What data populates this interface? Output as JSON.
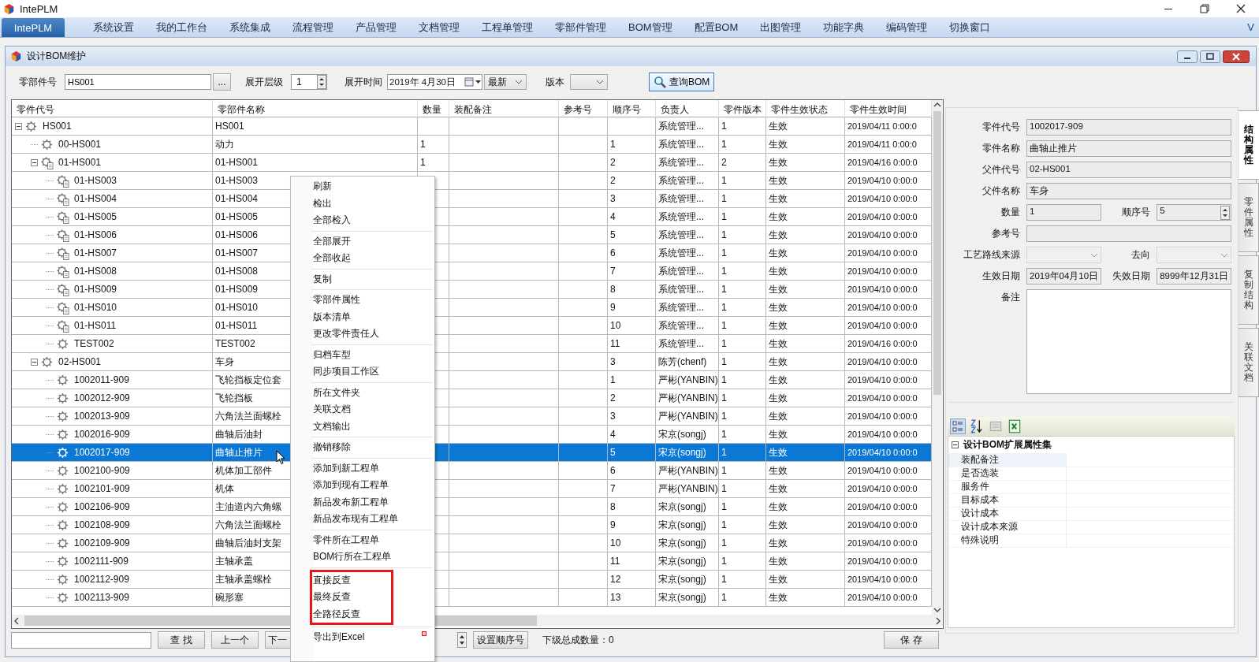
{
  "app_window": {
    "title": "IntePLM"
  },
  "menu_bar": {
    "items": [
      {
        "label": "IntePLM",
        "selected": true
      },
      {
        "label": "系统设置",
        "selected": false
      },
      {
        "label": "我的工作台",
        "selected": false
      },
      {
        "label": "系统集成",
        "selected": false
      },
      {
        "label": "流程管理",
        "selected": false
      },
      {
        "label": "产品管理",
        "selected": false
      },
      {
        "label": "文档管理",
        "selected": false
      },
      {
        "label": "工程单管理",
        "selected": false
      },
      {
        "label": "零部件管理",
        "selected": false
      },
      {
        "label": "BOM管理",
        "selected": false
      },
      {
        "label": "配置BOM",
        "selected": false
      },
      {
        "label": "出图管理",
        "selected": false
      },
      {
        "label": "功能字典",
        "selected": false
      },
      {
        "label": "编码管理",
        "selected": false
      },
      {
        "label": "切换窗口",
        "selected": false
      }
    ],
    "toggle": "V"
  },
  "document_window": {
    "title": "设计BOM维护"
  },
  "query_bar": {
    "part_no_label": "零部件号",
    "part_no": "HS001",
    "browse_button": "...",
    "level_label": "展开层级",
    "level": "1",
    "time_label": "展开时间",
    "date": "2019年 4月30日",
    "mode": "最新",
    "version_label": "版本",
    "query_button": "查询BOM"
  },
  "table": {
    "columns": [
      "零件代号",
      "零部件名称",
      "数量",
      "装配备注",
      "参考号",
      "顺序号",
      "负责人",
      "零件版本",
      "零件生效状态",
      "零件生效时间"
    ],
    "rows": [
      {
        "code": "HS001",
        "name": "HS001",
        "owner": "系统管理...",
        "version": "1",
        "status": "生效",
        "time": "2019/04/11 0:00:0",
        "kind": "plain",
        "selected": false,
        "expanded": true,
        "children": [
          {
            "code": "00-HS001",
            "name": "动力",
            "qty": "1",
            "seq": "1",
            "owner": "系统管理...",
            "version": "1",
            "status": "生效",
            "time": "2019/04/11 0:00:0",
            "kind": "plain",
            "selected": false
          },
          {
            "code": "01-HS001",
            "name": "01-HS001",
            "qty": "1",
            "seq": "2",
            "owner": "系统管理...",
            "version": "2",
            "status": "生效",
            "time": "2019/04/16 0:00:0",
            "kind": "documented",
            "selected": false,
            "expanded": true,
            "children": [
              {
                "code": "01-HS003",
                "name": "01-HS003",
                "seq": "2",
                "owner": "系统管理...",
                "version": "1",
                "status": "生效",
                "time": "2019/04/10 0:00:0",
                "kind": "documented",
                "selected": false
              },
              {
                "code": "01-HS004",
                "name": "01-HS004",
                "seq": "3",
                "owner": "系统管理...",
                "version": "1",
                "status": "生效",
                "time": "2019/04/10 0:00:0",
                "kind": "documented",
                "selected": false
              },
              {
                "code": "01-HS005",
                "name": "01-HS005",
                "seq": "4",
                "owner": "系统管理...",
                "version": "1",
                "status": "生效",
                "time": "2019/04/10 0:00:0",
                "kind": "documented",
                "selected": false
              },
              {
                "code": "01-HS006",
                "name": "01-HS006",
                "seq": "5",
                "owner": "系统管理...",
                "version": "1",
                "status": "生效",
                "time": "2019/04/10 0:00:0",
                "kind": "documented",
                "selected": false
              },
              {
                "code": "01-HS007",
                "name": "01-HS007",
                "seq": "6",
                "owner": "系统管理...",
                "version": "1",
                "status": "生效",
                "time": "2019/04/10 0:00:0",
                "kind": "documented",
                "selected": false
              },
              {
                "code": "01-HS008",
                "name": "01-HS008",
                "seq": "7",
                "owner": "系统管理...",
                "version": "1",
                "status": "生效",
                "time": "2019/04/10 0:00:0",
                "kind": "documented",
                "selected": false
              },
              {
                "code": "01-HS009",
                "name": "01-HS009",
                "seq": "8",
                "owner": "系统管理...",
                "version": "1",
                "status": "生效",
                "time": "2019/04/10 0:00:0",
                "kind": "documented",
                "selected": false
              },
              {
                "code": "01-HS010",
                "name": "01-HS010",
                "seq": "9",
                "owner": "系统管理...",
                "version": "1",
                "status": "生效",
                "time": "2019/04/10 0:00:0",
                "kind": "documented",
                "selected": false
              },
              {
                "code": "01-HS011",
                "name": "01-HS011",
                "seq": "10",
                "owner": "系统管理...",
                "version": "1",
                "status": "生效",
                "time": "2019/04/10 0:00:0",
                "kind": "documented",
                "selected": false
              },
              {
                "code": "TEST002",
                "name": "TEST002",
                "seq": "11",
                "owner": "系统管理...",
                "version": "1",
                "status": "生效",
                "time": "2019/04/16 0:00:0",
                "kind": "plain",
                "selected": false
              }
            ]
          },
          {
            "code": "02-HS001",
            "name": "车身",
            "seq": "3",
            "owner": "陈芳(chenf)",
            "version": "1",
            "status": "生效",
            "time": "2019/04/10 0:00:0",
            "kind": "plain",
            "selected": false,
            "expanded": true,
            "children": [
              {
                "code": "1002011-909",
                "name": "飞轮挡板定位套",
                "seq": "1",
                "owner": "严彬(YANBIN)",
                "version": "1",
                "status": "生效",
                "time": "2019/04/10 0:00:0",
                "kind": "plain",
                "selected": false
              },
              {
                "code": "1002012-909",
                "name": "飞轮挡板",
                "seq": "2",
                "owner": "严彬(YANBIN)",
                "version": "1",
                "status": "生效",
                "time": "2019/04/10 0:00:0",
                "kind": "plain",
                "selected": false
              },
              {
                "code": "1002013-909",
                "name": "六角法兰面螺栓",
                "seq": "3",
                "owner": "严彬(YANBIN)",
                "version": "1",
                "status": "生效",
                "time": "2019/04/10 0:00:0",
                "kind": "plain",
                "selected": false
              },
              {
                "code": "1002016-909",
                "name": "曲轴后油封",
                "seq": "4",
                "owner": "宋京(songj)",
                "version": "1",
                "status": "生效",
                "time": "2019/04/10 0:00:0",
                "kind": "plain",
                "selected": false
              },
              {
                "code": "1002017-909",
                "name": "曲轴止推片",
                "seq": "5",
                "owner": "宋京(songj)",
                "version": "1",
                "status": "生效",
                "time": "2019/04/10 0:00:0",
                "kind": "plain",
                "selected": true
              },
              {
                "code": "1002100-909",
                "name": "机体加工部件",
                "seq": "6",
                "owner": "严彬(YANBIN)",
                "version": "1",
                "status": "生效",
                "time": "2019/04/10 0:00:0",
                "kind": "plain",
                "selected": false
              },
              {
                "code": "1002101-909",
                "name": "机体",
                "seq": "7",
                "owner": "严彬(YANBIN)",
                "version": "1",
                "status": "生效",
                "time": "2019/04/10 0:00:0",
                "kind": "plain",
                "selected": false
              },
              {
                "code": "1002106-909",
                "name": "主油道内六角螺",
                "seq": "8",
                "owner": "宋京(songj)",
                "version": "1",
                "status": "生效",
                "time": "2019/04/10 0:00:0",
                "kind": "plain",
                "selected": false
              },
              {
                "code": "1002108-909",
                "name": "六角法兰面螺栓",
                "seq": "9",
                "owner": "宋京(songj)",
                "version": "1",
                "status": "生效",
                "time": "2019/04/10 0:00:0",
                "kind": "plain",
                "selected": false
              },
              {
                "code": "1002109-909",
                "name": "曲轴后油封支架",
                "seq": "10",
                "owner": "宋京(songj)",
                "version": "1",
                "status": "生效",
                "time": "2019/04/10 0:00:0",
                "kind": "plain",
                "selected": false
              },
              {
                "code": "1002111-909",
                "name": "主轴承盖",
                "seq": "11",
                "owner": "宋京(songj)",
                "version": "1",
                "status": "生效",
                "time": "2019/04/10 0:00:0",
                "kind": "plain",
                "selected": false
              },
              {
                "code": "1002112-909",
                "name": "主轴承盖螺栓",
                "seq": "12",
                "owner": "宋京(songj)",
                "version": "1",
                "status": "生效",
                "time": "2019/04/10 0:00:0",
                "kind": "plain",
                "selected": false
              },
              {
                "code": "1002113-909",
                "name": "碗形塞",
                "seq": "13",
                "owner": "宋京(songj)",
                "version": "1",
                "status": "生效",
                "time": "2019/04/10 0:00:0",
                "kind": "plain",
                "selected": false
              }
            ]
          }
        ]
      }
    ]
  },
  "bottom_bar": {
    "find_button": "查 找",
    "prev_button": "上一个",
    "next_button": "下一",
    "set_order_button": "设置顺序号",
    "count_label": "下级总成数量：0",
    "save_button": "保 存"
  },
  "context_menu": {
    "groups": [
      {
        "boxed": false,
        "items": [
          "刷新",
          "检出",
          "全部检入"
        ]
      },
      {
        "boxed": false,
        "items": [
          "全部展开",
          "全部收起"
        ]
      },
      {
        "boxed": false,
        "items": [
          "复制"
        ]
      },
      {
        "boxed": false,
        "items": [
          "零部件属性",
          "版本清单",
          "更改零件责任人"
        ]
      },
      {
        "boxed": false,
        "items": [
          "归档车型",
          "同步项目工作区"
        ]
      },
      {
        "boxed": false,
        "items": [
          "所在文件夹",
          "关联文档",
          "文档输出"
        ]
      },
      {
        "boxed": false,
        "items": [
          "撤销移除"
        ]
      },
      {
        "boxed": false,
        "items": [
          "添加到新工程单",
          "添加到现有工程单",
          "新品发布新工程单",
          "新品发布现有工程单"
        ]
      },
      {
        "boxed": false,
        "items": [
          "零件所在工程单",
          "BOM行所在工程单"
        ]
      },
      {
        "boxed": true,
        "items": [
          "直接反查",
          "最终反查",
          "全路径反查"
        ]
      },
      {
        "boxed": false,
        "items": [
          "导出到Excel"
        ]
      }
    ]
  },
  "side_tabs": [
    {
      "label": "结构属性",
      "selected": true
    },
    {
      "label": "零件属性",
      "selected": false
    },
    {
      "label": "复制结构",
      "selected": false
    },
    {
      "label": "关联文档",
      "selected": false
    }
  ],
  "structure_form": {
    "rows": [
      [
        {
          "kind": "text",
          "label": "零件代号",
          "value": "1002017-909"
        }
      ],
      [
        {
          "kind": "text",
          "label": "零件名称",
          "value": "曲轴止推片"
        }
      ],
      [
        {
          "kind": "text",
          "label": "父件代号",
          "value": "02-HS001"
        }
      ],
      [
        {
          "kind": "text",
          "label": "父件名称",
          "value": "车身"
        }
      ],
      [
        {
          "kind": "text",
          "label": "数量",
          "value": "1"
        },
        {
          "kind": "spin",
          "label": "顺序号",
          "value": "5"
        }
      ],
      [
        {
          "kind": "text",
          "label": "参考号"
        }
      ],
      [
        {
          "kind": "combo",
          "label": "工艺路线来源",
          "disabled": true
        },
        {
          "kind": "combo",
          "label": "去向",
          "disabled": true
        }
      ],
      [
        {
          "kind": "text",
          "label": "生效日期",
          "value": "2019年04月10日"
        },
        {
          "kind": "text",
          "label": "失效日期",
          "value": "8999年12月31日"
        }
      ],
      [
        {
          "kind": "memo",
          "label": "备注"
        }
      ]
    ]
  },
  "property_grid": {
    "group": {
      "title": "设计BOM扩展属性集",
      "expanded": true,
      "items": [
        {
          "name": "装配备注",
          "selected": true
        },
        {
          "name": "是否选装",
          "selected": false
        },
        {
          "name": "服务件",
          "selected": false
        },
        {
          "name": "目标成本",
          "selected": false
        },
        {
          "name": "设计成本",
          "selected": false
        },
        {
          "name": "设计成本来源",
          "selected": false
        },
        {
          "name": "特殊说明",
          "selected": false
        }
      ]
    }
  }
}
